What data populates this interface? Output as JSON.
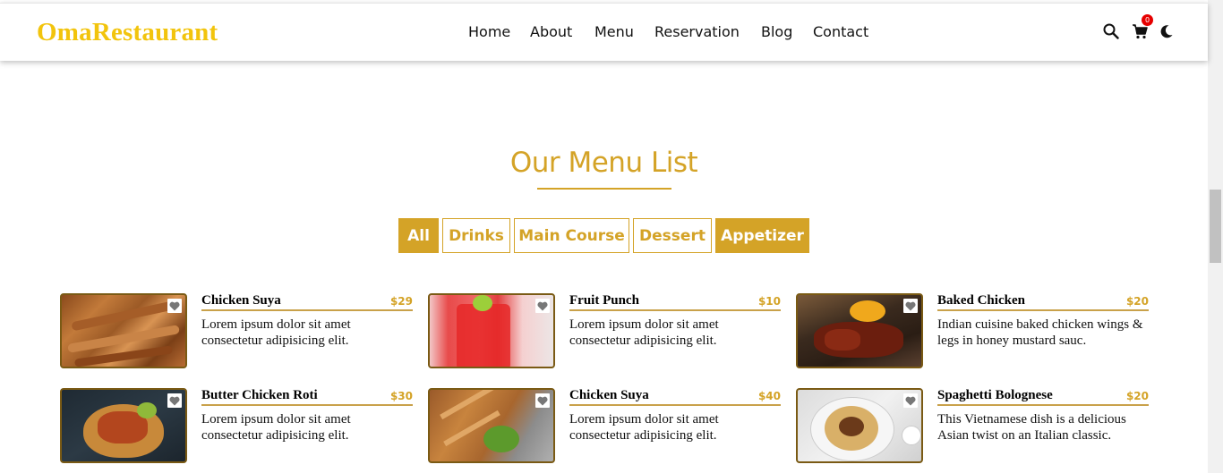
{
  "brand": {
    "name": "OmaRestaurant",
    "color": "#f2c40d"
  },
  "nav": {
    "items": [
      "Home",
      "About",
      "Menu",
      "Reservation",
      "Blog",
      "Contact"
    ]
  },
  "header_icons": {
    "search": "search-icon",
    "cart": "cart-icon",
    "cart_count": "0",
    "theme": "moon-icon"
  },
  "section": {
    "title": "Our Menu List",
    "accent": "#d4a327"
  },
  "filters": [
    {
      "label": "All",
      "active": true
    },
    {
      "label": "Drinks",
      "active": false
    },
    {
      "label": "Main Course",
      "active": false
    },
    {
      "label": "Dessert",
      "active": false
    },
    {
      "label": "Appetizer",
      "active": true
    }
  ],
  "menu": [
    {
      "name": "Chicken Suya",
      "price": "$29",
      "desc": "Lorem ipsum dolor sit amet consectetur adipisicing elit."
    },
    {
      "name": "Fruit Punch",
      "price": "$10",
      "desc": "Lorem ipsum dolor sit amet consectetur adipisicing elit."
    },
    {
      "name": "Baked Chicken",
      "price": "$20",
      "desc": "Indian cuisine baked chicken wings & legs in honey mustard sauc."
    },
    {
      "name": "Butter Chicken Roti",
      "price": "$30",
      "desc": "Lorem ipsum dolor sit amet consectetur adipisicing elit."
    },
    {
      "name": "Chicken Suya",
      "price": "$40",
      "desc": "Lorem ipsum dolor sit amet consectetur adipisicing elit."
    },
    {
      "name": "Spaghetti Bolognese",
      "price": "$20",
      "desc": "This Vietnamese dish is a delicious Asian twist on an Italian classic."
    }
  ]
}
